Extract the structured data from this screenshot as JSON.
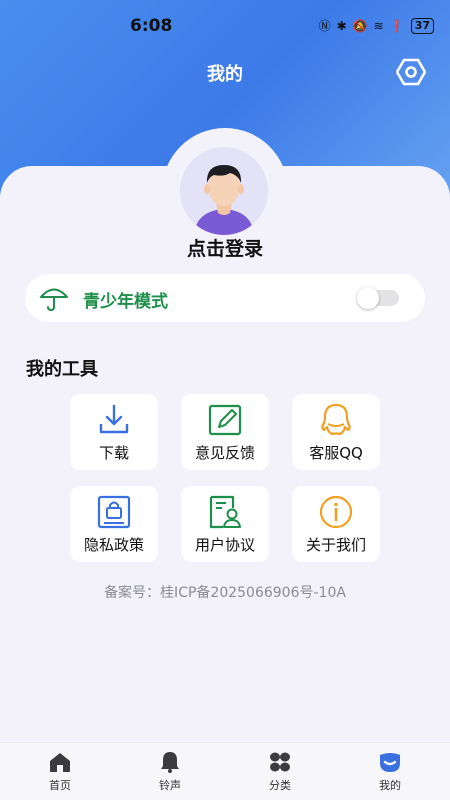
{
  "status_bar": {
    "time": "6:08",
    "battery": "37"
  },
  "header": {
    "title": "我的"
  },
  "profile": {
    "login_text": "点击登录"
  },
  "teen_mode": {
    "label": "青少年模式",
    "enabled": false,
    "color": "#1e8f4a"
  },
  "tools": {
    "section_title": "我的工具",
    "items": [
      {
        "label": "下载",
        "icon": "download-icon"
      },
      {
        "label": "意见反馈",
        "icon": "feedback-icon"
      },
      {
        "label": "客服QQ",
        "icon": "qq-icon"
      },
      {
        "label": "隐私政策",
        "icon": "privacy-lock-icon"
      },
      {
        "label": "用户协议",
        "icon": "user-agreement-icon"
      },
      {
        "label": "关于我们",
        "icon": "info-icon"
      }
    ]
  },
  "footer": {
    "icp": "备案号：桂ICP备2025066906号-10A"
  },
  "tabbar": {
    "items": [
      {
        "label": "首页",
        "icon": "home-icon"
      },
      {
        "label": "铃声",
        "icon": "bell-icon"
      },
      {
        "label": "分类",
        "icon": "category-icon"
      },
      {
        "label": "我的",
        "icon": "mine-icon",
        "active": true
      }
    ]
  },
  "colors": {
    "header_blue": "#3c7ae8",
    "accent_blue": "#3a6fe0",
    "green": "#1e8f4a",
    "orange": "#f0a020"
  }
}
